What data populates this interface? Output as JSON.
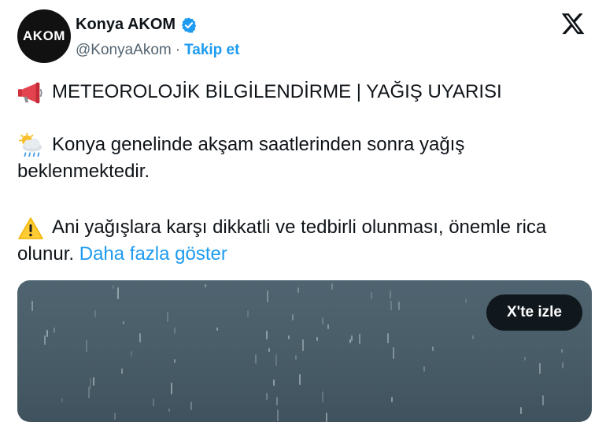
{
  "account": {
    "avatar_text": "AKOM",
    "display_name": "Konya AKOM",
    "handle": "@KonyaAkom",
    "separator": "·",
    "follow_label": "Takip et",
    "verified": true
  },
  "post": {
    "line1": "METEOROLOJİK BİLGİLENDİRME | YAĞIŞ UYARISI",
    "line2": "Konya genelinde akşam saatlerinden sonra yağış beklenmektedir.",
    "line3": "Ani yağışlara karşı dikkatli ve tedbirli olunması, önemle rica olunur.",
    "show_more": "Daha fazla göster"
  },
  "media": {
    "watch_label": "X'te izle"
  },
  "icons": {
    "line1": "megaphone-icon",
    "line2": "rain-cloud-icon",
    "line3": "warning-icon",
    "logo": "x-logo-icon"
  },
  "colors": {
    "link": "#1d9bf0",
    "verified": "#1d9bf0",
    "text": "#0f1419",
    "secondary": "#536471"
  }
}
